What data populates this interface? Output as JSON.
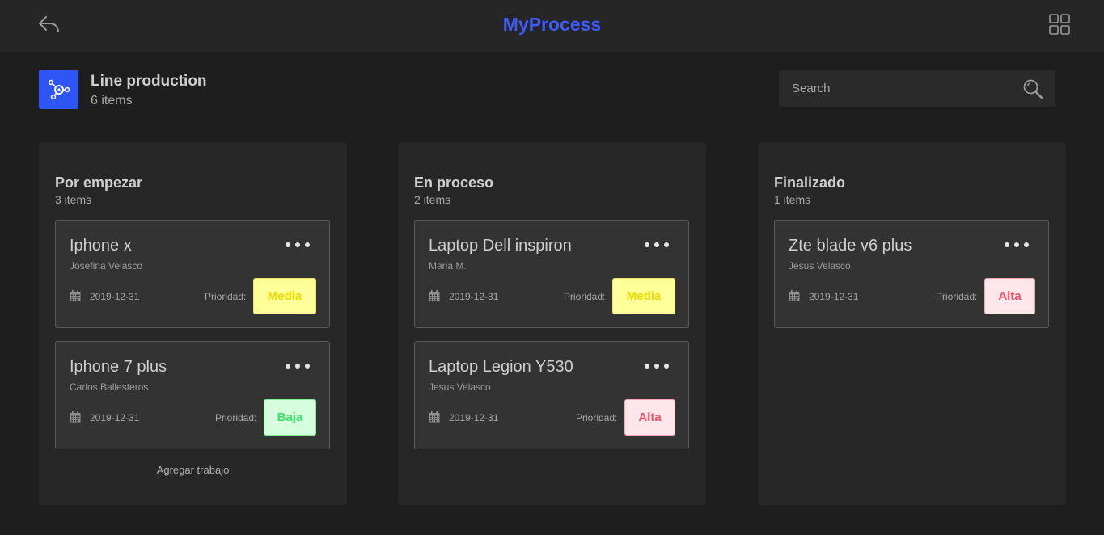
{
  "header": {
    "title": "MyProcess",
    "back_icon": "reply-arrow-icon",
    "menu_icon": "grid-icon"
  },
  "board": {
    "title": "Line production",
    "count": "6 items",
    "icon": "process-nodes-icon",
    "icon_color": "#2f55f5"
  },
  "search": {
    "placeholder": "Search",
    "value": ""
  },
  "columns": [
    {
      "title": "Por empezar",
      "count": "3 items",
      "cards": [
        {
          "title": "Iphone x",
          "owner": "Josefina Velasco",
          "date": "2019-12-31",
          "priority_label": "Prioridad:",
          "priority": "Media"
        },
        {
          "title": "Iphone 7 plus",
          "owner": "Carlos Ballesteros",
          "date": "2019-12-31",
          "priority_label": "Prioridad:",
          "priority": "Baja"
        }
      ],
      "add_label": "Agregar trabajo"
    },
    {
      "title": "En proceso",
      "count": "2 items",
      "cards": [
        {
          "title": "Laptop Dell inspiron",
          "owner": "Maria M.",
          "date": "2019-12-31",
          "priority_label": "Prioridad:",
          "priority": "Media"
        },
        {
          "title": "Laptop Legion Y530",
          "owner": "Jesus Velasco",
          "date": "2019-12-31",
          "priority_label": "Prioridad:",
          "priority": "Alta"
        }
      ]
    },
    {
      "title": "Finalizado",
      "count": "1 items",
      "cards": [
        {
          "title": "Zte blade v6 plus",
          "owner": "Jesus Velasco",
          "date": "2019-12-31",
          "priority_label": "Prioridad:",
          "priority": "Alta"
        }
      ]
    }
  ],
  "colors": {
    "accent": "#3d5bf5",
    "media": "#ffff9a",
    "baja": "#d5ffdc",
    "alta": "#ffe6ea"
  }
}
